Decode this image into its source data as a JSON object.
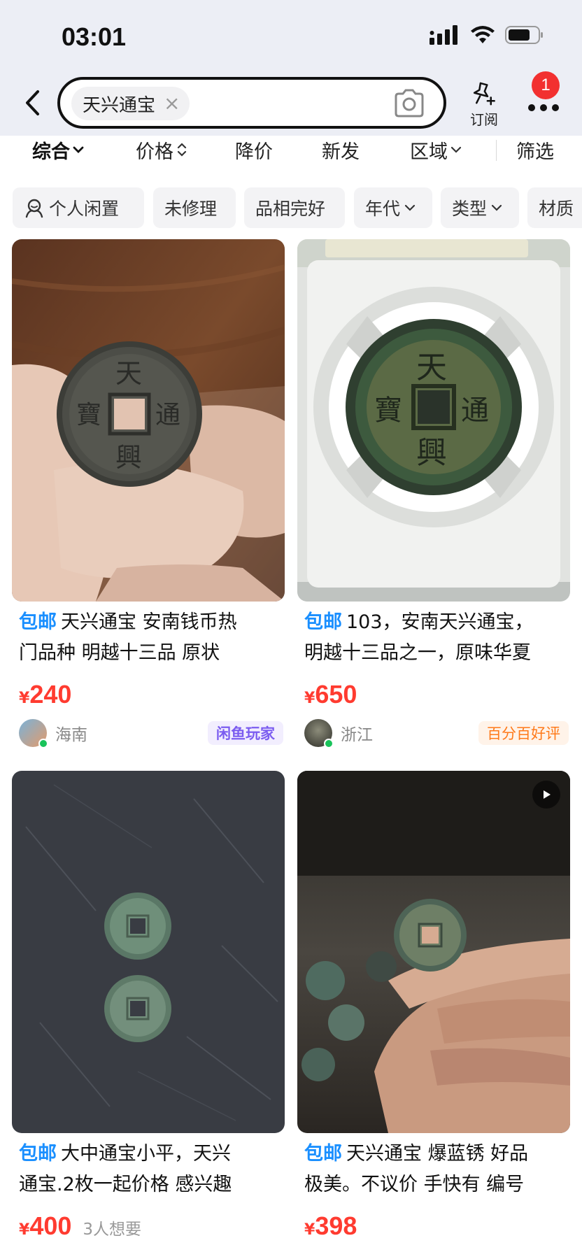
{
  "status_bar": {
    "time": "03:01"
  },
  "search": {
    "query": "天兴通宝",
    "subscribe_label": "订阅",
    "badge_count": "1"
  },
  "sort_bar": {
    "items": [
      "综合",
      "价格",
      "降价",
      "新发",
      "区域",
      "筛选"
    ]
  },
  "filters": [
    "个人闲置",
    "未修理",
    "品相完好",
    "年代",
    "类型",
    "材质"
  ],
  "products": [
    {
      "freeship": "包邮",
      "title_line1": "天兴通宝  安南钱币热",
      "title_line2": "门品种  明越十三品    原状",
      "price_symbol": "¥",
      "price": "240",
      "want": "",
      "location": "海南",
      "tag": "闲鱼玩家"
    },
    {
      "freeship": "包邮",
      "title_line1": "103，安南天兴通宝，",
      "title_line2": "明越十三品之一，原味华夏",
      "price_symbol": "¥",
      "price": "650",
      "want": "",
      "location": "浙江",
      "tag": "百分百好评"
    },
    {
      "freeship": "包邮",
      "title_line1": "大中通宝小平，天兴",
      "title_line2": "通宝.2枚一起价格 感兴趣",
      "price_symbol": "¥",
      "price": "400",
      "want": "3人想要",
      "location": "",
      "tag": ""
    },
    {
      "freeship": "包邮",
      "title_line1": "天兴通宝 爆蓝锈 好品",
      "title_line2": "极美。不议价 手快有 编号",
      "price_symbol": "¥",
      "price": "398",
      "want": "",
      "location": "",
      "tag": ""
    }
  ],
  "colors": {
    "accent_blue": "#1a8fff",
    "price_red": "#ff3b30",
    "header_bg": "#eceef5"
  }
}
